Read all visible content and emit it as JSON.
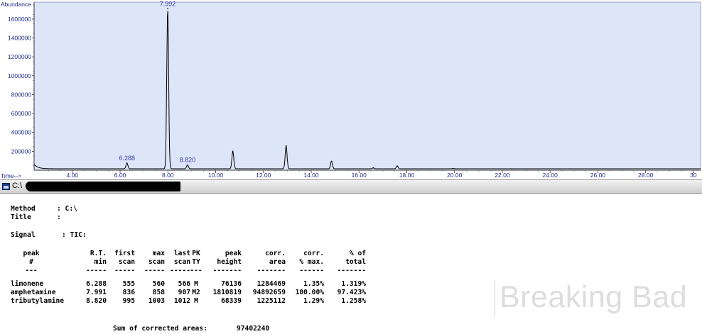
{
  "chart_data": {
    "type": "line",
    "ylabel": "Abundance",
    "xlabel": "Time-->",
    "xlim": [
      2.4,
      30.3
    ],
    "ylim": [
      0,
      1780000
    ],
    "yticks": [
      200000,
      400000,
      600000,
      800000,
      1000000,
      1200000,
      1400000,
      1600000
    ],
    "ytick_labels": [
      "200000",
      "400000",
      "600000",
      "800000",
      "1000000",
      "1200000",
      "1400000",
      "1600000"
    ],
    "xticks": [
      4,
      6,
      8,
      10,
      12,
      14,
      16,
      18,
      20,
      22,
      24,
      26,
      28,
      30
    ],
    "xtick_labels": [
      "4.00",
      "6.00",
      "8.00",
      "10.00",
      "12.00",
      "14.00",
      "16.00",
      "18.00",
      "20.00",
      "22.00",
      "24.00",
      "26.00",
      "28.00",
      "30"
    ],
    "baseline": 15000,
    "start_tail": 45000,
    "peaks": [
      {
        "x": 6.288,
        "y": 76136,
        "label": "6.288"
      },
      {
        "x": 7.992,
        "y": 1710000,
        "label": "7.992"
      },
      {
        "x": 8.82,
        "y": 55000,
        "label": "8.820"
      },
      {
        "x": 10.72,
        "y": 200000
      },
      {
        "x": 12.95,
        "y": 260000
      },
      {
        "x": 14.85,
        "y": 95000
      },
      {
        "x": 16.6,
        "y": 25000
      },
      {
        "x": 17.6,
        "y": 45000
      },
      {
        "x": 19.95,
        "y": 18000
      },
      {
        "x": 22.4,
        "y": 15000
      }
    ],
    "colors": {
      "plot_bg": "#dde5f8",
      "trace": "#000000",
      "axis_text": "#1f2e8a",
      "peak_label": "#3a46a8"
    }
  },
  "window": {
    "title": "C:\\"
  },
  "report": {
    "method_label": "Method",
    "method_value": ": C:\\",
    "title_label": "Title",
    "title_value": ":",
    "signal_label": "Signal",
    "signal_value": ": TIC:",
    "headers": {
      "row1": [
        "peak",
        "R.T.",
        "first",
        "max",
        "last",
        "PK",
        "peak",
        "corr.",
        "corr.",
        "% of"
      ],
      "row2": [
        "#",
        "min",
        "scan",
        "scan",
        "scan",
        "TY",
        "height",
        "area",
        "% max.",
        "total"
      ],
      "row3": [
        "---",
        "-----",
        "-----",
        "-----",
        "-----",
        "---",
        "-------",
        "-------",
        "------",
        "-------"
      ]
    },
    "rows": [
      [
        "limonene",
        "6.288",
        "555",
        "560",
        "566",
        "M",
        "76136",
        "1284469",
        "1.35%",
        "1.319%"
      ],
      [
        "amphetamine",
        "7.991",
        "836",
        "858",
        "907",
        "M2",
        "1810819",
        "94892659",
        "100.00%",
        "97.423%"
      ],
      [
        "tributylamine",
        "8.820",
        "995",
        "1003",
        "1012",
        "M",
        "68339",
        "1225112",
        "1.29%",
        "1.258%"
      ]
    ],
    "sum_label": "Sum of corrected areas:",
    "sum_value": "97402240"
  },
  "watermark": {
    "text": "Breaking Bad"
  }
}
